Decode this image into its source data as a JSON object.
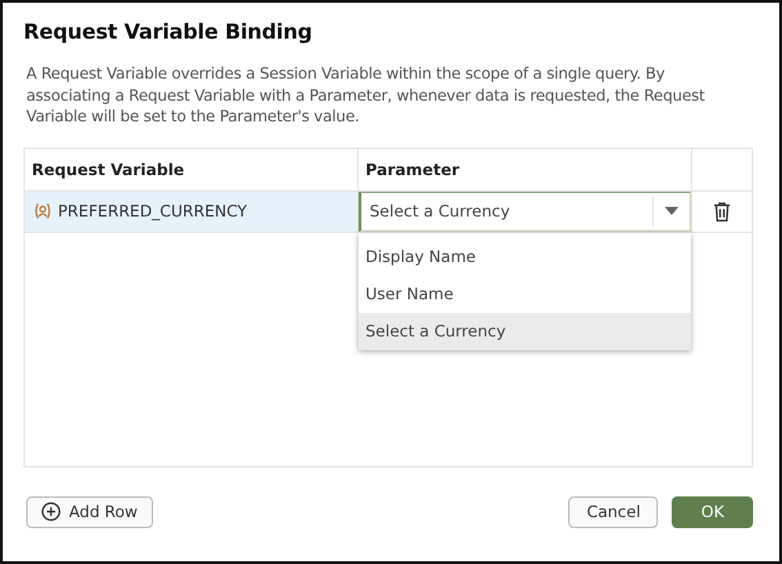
{
  "dialog": {
    "title": "Request Variable Binding",
    "description": "A Request Variable overrides a Session Variable within the scope of a single query. By associating a Request Variable with a Parameter, whenever data is requested, the Request Variable will be set to the Parameter's value."
  },
  "table": {
    "columns": [
      "Request Variable",
      "Parameter"
    ],
    "rows": [
      {
        "variable": "PREFERRED_CURRENCY",
        "selected": true,
        "parameter": "Select a Currency",
        "expanded": true,
        "options": [
          {
            "label": "Display Name",
            "selected": false
          },
          {
            "label": "User Name",
            "selected": false
          },
          {
            "label": "Select a Currency",
            "selected": true
          }
        ]
      }
    ]
  },
  "buttons": {
    "add": "Add Row",
    "cancel": "Cancel",
    "ok": "OK"
  }
}
